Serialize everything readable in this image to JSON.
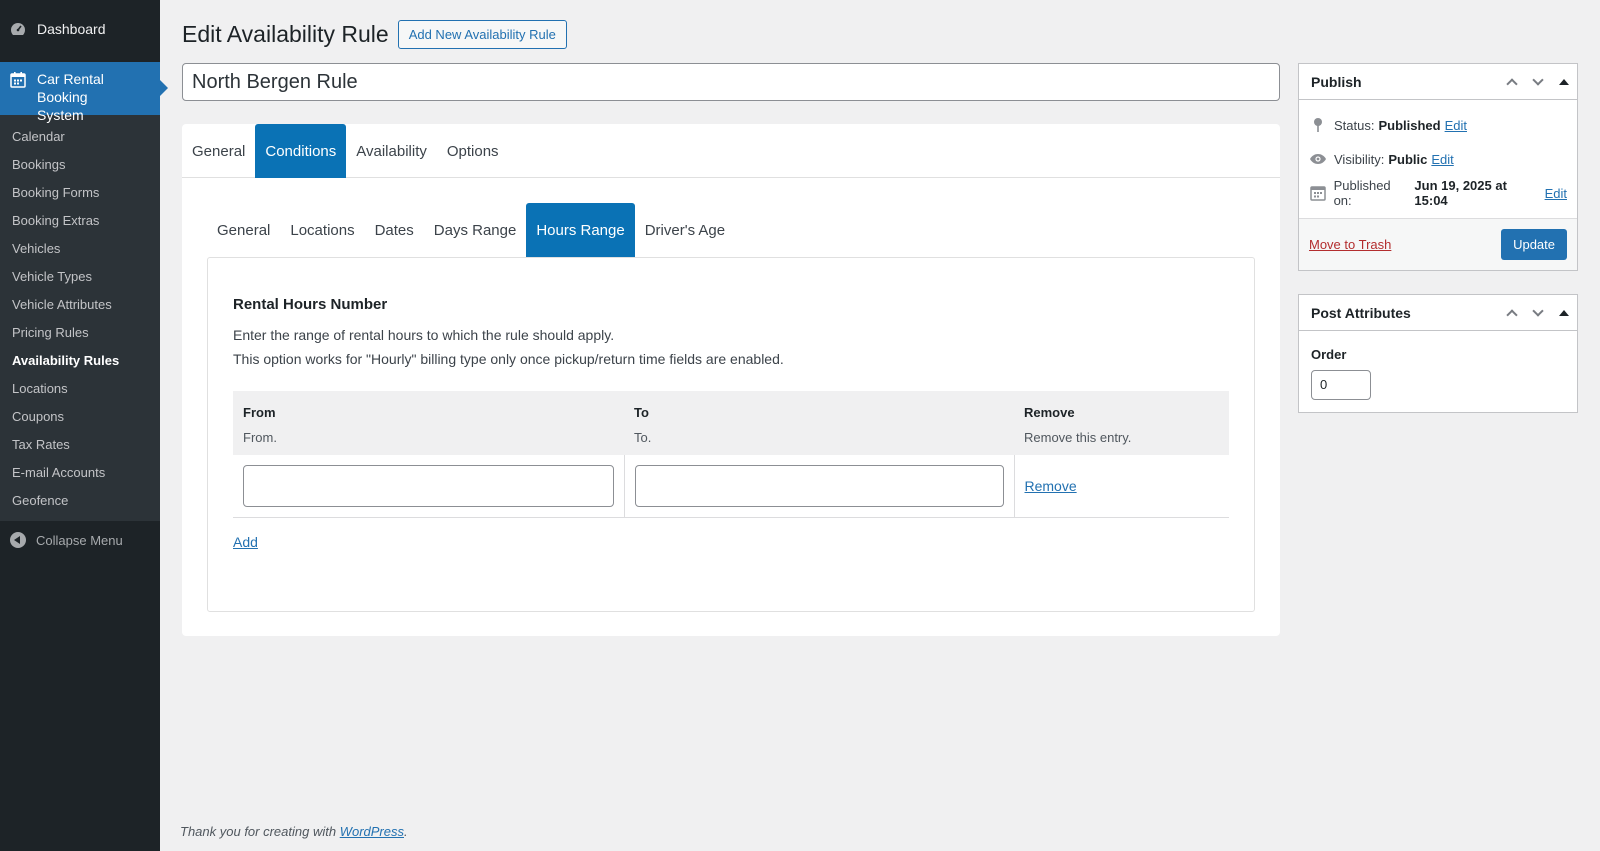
{
  "sidebar": {
    "dashboard": "Dashboard",
    "current_menu": "Car Rental Booking System",
    "items": [
      {
        "label": "Calendar"
      },
      {
        "label": "Bookings"
      },
      {
        "label": "Booking Forms"
      },
      {
        "label": "Booking Extras"
      },
      {
        "label": "Vehicles"
      },
      {
        "label": "Vehicle Types"
      },
      {
        "label": "Vehicle Attributes"
      },
      {
        "label": "Pricing Rules"
      },
      {
        "label": "Availability Rules"
      },
      {
        "label": "Locations"
      },
      {
        "label": "Coupons"
      },
      {
        "label": "Tax Rates"
      },
      {
        "label": "E-mail Accounts"
      },
      {
        "label": "Geofence"
      }
    ],
    "collapse": "Collapse Menu"
  },
  "header": {
    "title": "Edit Availability Rule",
    "add_new": "Add New Availability Rule"
  },
  "post_title": "North Bergen Rule",
  "main_tabs": [
    {
      "label": "General"
    },
    {
      "label": "Conditions"
    },
    {
      "label": "Availability"
    },
    {
      "label": "Options"
    }
  ],
  "sub_tabs": [
    {
      "label": "General"
    },
    {
      "label": "Locations"
    },
    {
      "label": "Dates"
    },
    {
      "label": "Days Range"
    },
    {
      "label": "Hours Range"
    },
    {
      "label": "Driver's Age"
    }
  ],
  "section": {
    "title": "Rental Hours Number",
    "desc1": "Enter the range of rental hours to which the rule should apply.",
    "desc2": "This option works for \"Hourly\" billing type only once pickup/return time fields are enabled."
  },
  "table": {
    "columns": [
      {
        "header": "From",
        "sub": "From."
      },
      {
        "header": "To",
        "sub": "To."
      },
      {
        "header": "Remove",
        "sub": "Remove this entry."
      }
    ],
    "row": {
      "from": "",
      "to": "",
      "remove": "Remove"
    },
    "add": "Add"
  },
  "publish": {
    "title": "Publish",
    "status_label": "Status:",
    "status_value": "Published",
    "visibility_label": "Visibility:",
    "visibility_value": "Public",
    "published_label": "Published on:",
    "published_value": "Jun 19, 2025 at 15:04",
    "edit": "Edit",
    "trash": "Move to Trash",
    "update": "Update"
  },
  "attributes": {
    "title": "Post Attributes",
    "order_label": "Order",
    "order_value": "0"
  },
  "footer": {
    "text": "Thank you for creating with",
    "link": "WordPress",
    "end": "."
  },
  "colors": {
    "accent": "#2271b1",
    "tab_active": "#0a72b5",
    "sidebar": "#1d2327"
  }
}
